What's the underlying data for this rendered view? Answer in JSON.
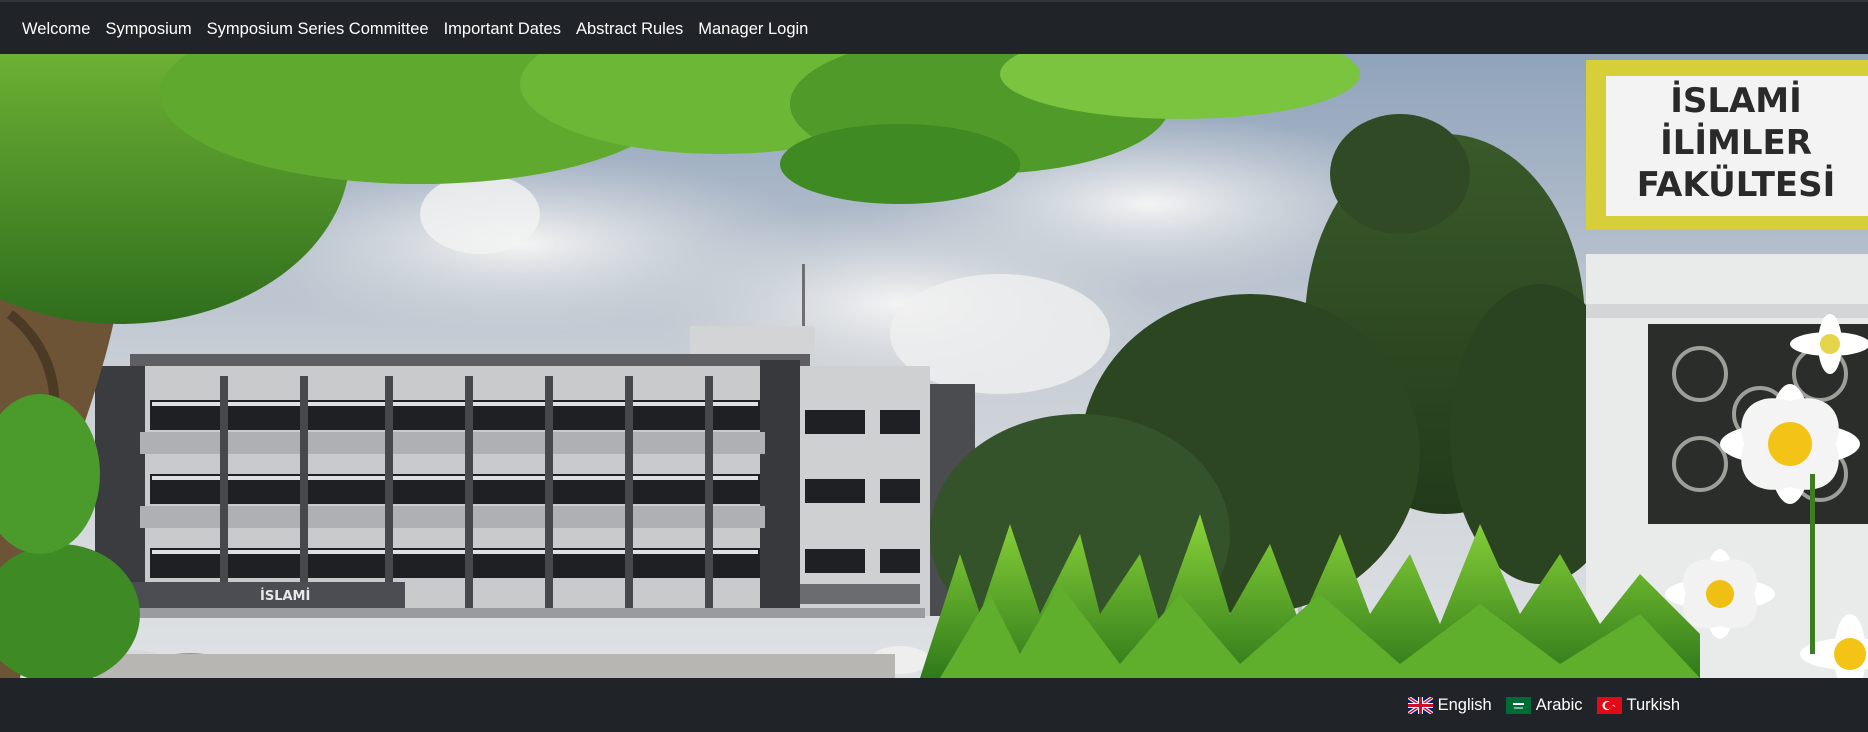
{
  "nav": {
    "items": [
      {
        "label": "Welcome"
      },
      {
        "label": "Symposium"
      },
      {
        "label": "Symposium Series Committee"
      },
      {
        "label": "Important Dates"
      },
      {
        "label": "Abstract Rules"
      },
      {
        "label": "Manager Login"
      }
    ]
  },
  "hero": {
    "sign_lines": [
      "İSLAMİ",
      "İLİMLER",
      "FAKÜLTESİ"
    ],
    "building_sign": "İSLAMİ"
  },
  "languages": [
    {
      "label": "English",
      "flag": "uk-flag-icon"
    },
    {
      "label": "Arabic",
      "flag": "saudi-flag-icon"
    },
    {
      "label": "Turkish",
      "flag": "turkey-flag-icon"
    }
  ],
  "colors": {
    "bar_background": "#202328",
    "sign_yellow": "#d6cf3a",
    "text": "#ffffff"
  }
}
